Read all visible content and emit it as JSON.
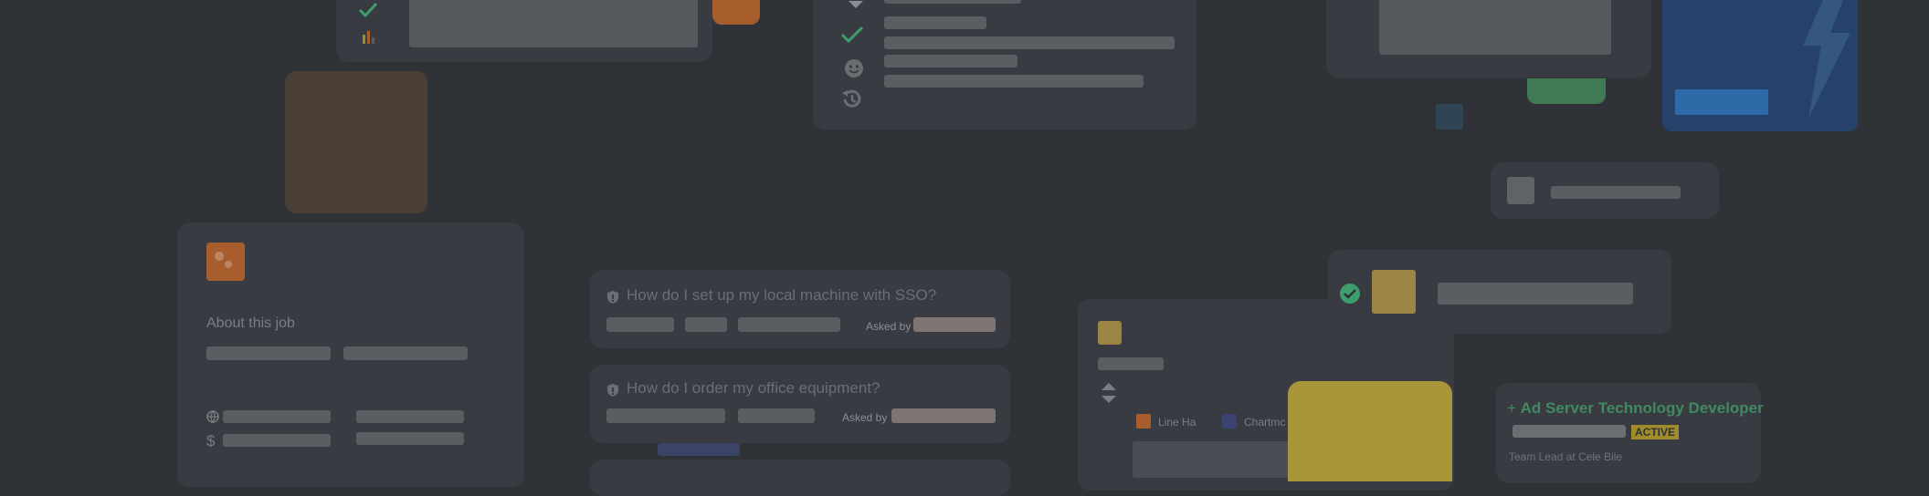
{
  "colors": {
    "background": "#2f3237",
    "card": "#383c42",
    "placeholder": "#5a5e63",
    "check_green": "#3f9e6e",
    "orange": "#a85e2c",
    "mustard": "#9c8444",
    "yellow": "#a8953a",
    "blue_panel": "#27426a",
    "blue_button": "#2f6aa8",
    "green_tab": "#3f7a55",
    "active_badge": "#a08c2a"
  },
  "job_card": {
    "about_title": "About this job",
    "icons": [
      "globe-icon",
      "dollar-icon"
    ]
  },
  "questions": [
    {
      "title": "How do I set up my local machine with SSO?",
      "asked_by": "Asked by"
    },
    {
      "title": "How do I order my office equipment?",
      "asked_by": "Asked by"
    }
  ],
  "chart_card": {
    "legend": [
      "Line Ha",
      "Chartmc"
    ]
  },
  "job_posting": {
    "title": "Ad Server Technology Developer",
    "status": "ACTIVE",
    "subtitle": "Team Lead at Cele Bile"
  },
  "checklist_icons": [
    "check-icon",
    "smiley-icon",
    "history-icon"
  ]
}
